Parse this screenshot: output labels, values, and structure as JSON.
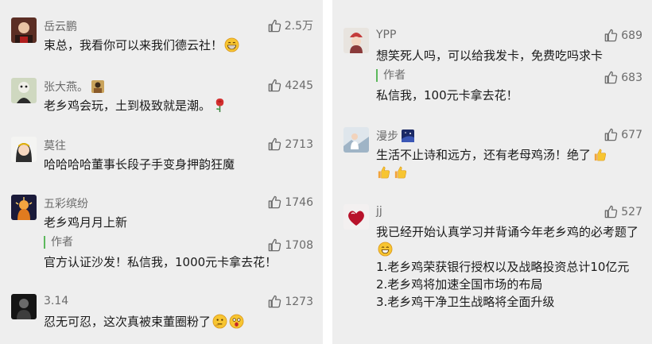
{
  "left": {
    "comments": [
      {
        "name": "岳云鹏",
        "likes": "2.5万",
        "text": "束总，我看你可以来我们德云社！"
      },
      {
        "name": "张大燕。",
        "likes": "4245",
        "text": "老乡鸡会玩，土到极致就是潮。"
      },
      {
        "name": "莫往",
        "likes": "2713",
        "text": "哈哈哈哈董事长段子手变身押韵狂魔"
      },
      {
        "name": "五彩缤纷",
        "likes": "1746",
        "text": "老乡鸡月月上新",
        "reply": {
          "author": "作者",
          "likes": "1708",
          "text": "官方认证沙发！私信我，1000元卡拿去花！"
        }
      },
      {
        "name": "3.14",
        "likes": "1273",
        "text": "忍无可忍，这次真被束董圈粉了"
      }
    ]
  },
  "right": {
    "comments": [
      {
        "name": "YPP",
        "likes": "689",
        "text": "想笑死人吗，可以给我发卡，免费吃吗求卡",
        "reply": {
          "author": "作者",
          "likes": "683",
          "text": "私信我，100元卡拿去花！"
        }
      },
      {
        "name": "漫步",
        "likes": "677",
        "text": "生活不止诗和远方，还有老母鸡汤！绝了"
      },
      {
        "name": "jj",
        "likes": "527",
        "lines": [
          "我已经开始认真学习并背诵今年老乡鸡的必考题了",
          "1.老乡鸡荣获银行授权以及战略投资总计10亿元",
          "2.老乡鸡将加速全国市场的布局",
          "3.老乡鸡干净卫生战略将全面升级"
        ]
      }
    ]
  },
  "icons": {
    "like": "thumbs-up-icon",
    "emojis": [
      "grinning-face-emoji",
      "rose-emoji",
      "thinking-face-emoji",
      "shocked-face-emoji",
      "thumbs-up-emoji",
      "laughing-face-emoji"
    ]
  },
  "colors": {
    "panel_bg": "#eeeeee",
    "meta_text": "#6b6b6b",
    "body_text": "#1a1a1a",
    "author_bar": "#5cb85c"
  }
}
